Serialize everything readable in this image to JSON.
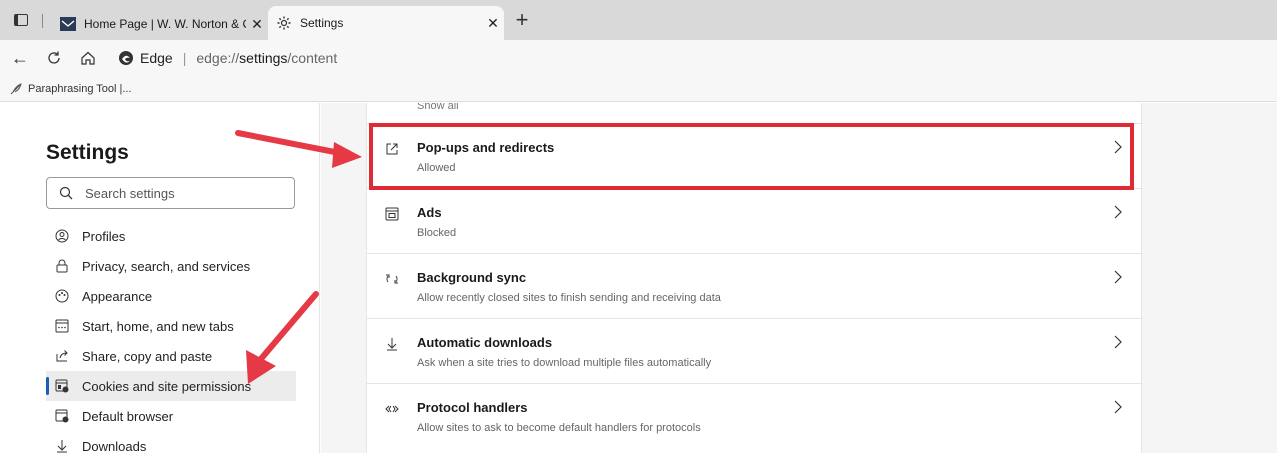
{
  "tabs": [
    {
      "title": "Home Page | W. W. Norton & Co",
      "icon": "norton-favicon",
      "active": false
    },
    {
      "title": "Settings",
      "icon": "gear-icon",
      "active": true
    }
  ],
  "address": {
    "browser_label": "Edge",
    "url_prefix": "edge://",
    "url_bold": "settings",
    "url_suffix": "/content"
  },
  "bookmarks": [
    {
      "label": "Paraphrasing Tool |..."
    }
  ],
  "sidebar": {
    "title": "Settings",
    "search_placeholder": "Search settings",
    "items": [
      {
        "label": "Profiles",
        "icon": "profile-icon"
      },
      {
        "label": "Privacy, search, and services",
        "icon": "lock-icon"
      },
      {
        "label": "Appearance",
        "icon": "appearance-icon"
      },
      {
        "label": "Start, home, and new tabs",
        "icon": "start-icon"
      },
      {
        "label": "Share, copy and paste",
        "icon": "share-icon"
      },
      {
        "label": "Cookies and site permissions",
        "icon": "cookies-icon",
        "selected": true
      },
      {
        "label": "Default browser",
        "icon": "browser-icon"
      },
      {
        "label": "Downloads",
        "icon": "download-icon"
      }
    ]
  },
  "content": {
    "show_all": "Show all",
    "rows": [
      {
        "name": "Pop-ups and redirects",
        "desc": "Allowed",
        "icon": "popup-icon"
      },
      {
        "name": "Ads",
        "desc": "Blocked",
        "icon": "ads-icon"
      },
      {
        "name": "Background sync",
        "desc": "Allow recently closed sites to finish sending and receiving data",
        "icon": "sync-icon"
      },
      {
        "name": "Automatic downloads",
        "desc": "Ask when a site tries to download multiple files automatically",
        "icon": "download-icon"
      },
      {
        "name": "Protocol handlers",
        "desc": "Allow sites to ask to become default handlers for protocols",
        "icon": "protocol-icon"
      }
    ]
  },
  "annotation": {
    "highlight_color": "#e02a36",
    "arrow_color": "#e53a45"
  }
}
